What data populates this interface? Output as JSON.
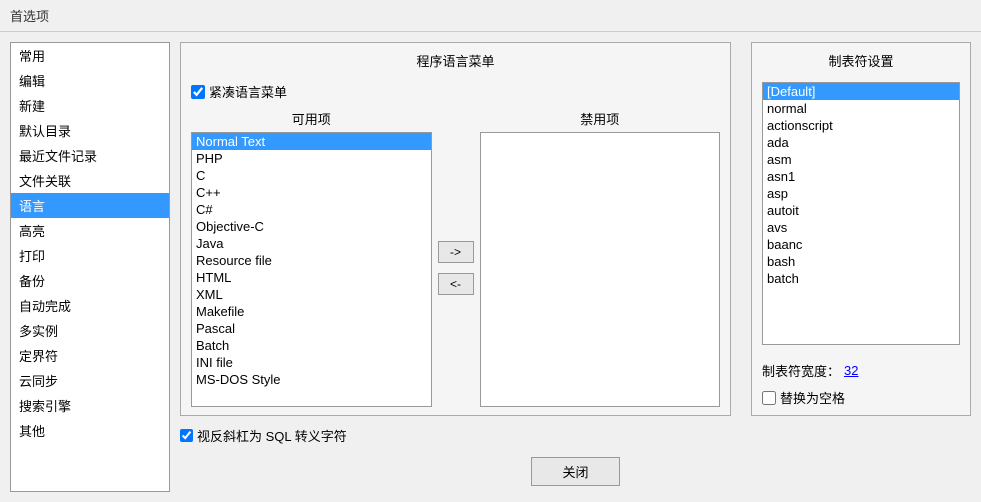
{
  "titleBar": {
    "title": "首选项"
  },
  "sidebar": {
    "items": [
      {
        "label": "常用",
        "active": false
      },
      {
        "label": "编辑",
        "active": false
      },
      {
        "label": "新建",
        "active": false
      },
      {
        "label": "默认目录",
        "active": false
      },
      {
        "label": "最近文件记录",
        "active": false
      },
      {
        "label": "文件关联",
        "active": false
      },
      {
        "label": "语言",
        "active": true
      },
      {
        "label": "高亮",
        "active": false
      },
      {
        "label": "打印",
        "active": false
      },
      {
        "label": "备份",
        "active": false
      },
      {
        "label": "自动完成",
        "active": false
      },
      {
        "label": "多实例",
        "active": false
      },
      {
        "label": "定界符",
        "active": false
      },
      {
        "label": "云同步",
        "active": false
      },
      {
        "label": "搜索引擎",
        "active": false
      },
      {
        "label": "其他",
        "active": false
      }
    ]
  },
  "langPanel": {
    "title": "程序语言菜单",
    "compactCheckbox": {
      "label": "紧凑语言菜单",
      "checked": true
    },
    "availableLabel": "可用项",
    "disabledLabel": "禁用项",
    "availableItems": [
      {
        "label": "Normal Text",
        "selected": true
      },
      {
        "label": "PHP",
        "selected": false
      },
      {
        "label": "C",
        "selected": false
      },
      {
        "label": "C++",
        "selected": false
      },
      {
        "label": "C#",
        "selected": false
      },
      {
        "label": "Objective-C",
        "selected": false
      },
      {
        "label": "Java",
        "selected": false
      },
      {
        "label": "Resource file",
        "selected": false
      },
      {
        "label": "HTML",
        "selected": false
      },
      {
        "label": "XML",
        "selected": false
      },
      {
        "label": "Makefile",
        "selected": false
      },
      {
        "label": "Pascal",
        "selected": false
      },
      {
        "label": "Batch",
        "selected": false
      },
      {
        "label": "INI file",
        "selected": false
      },
      {
        "label": "MS-DOS Style",
        "selected": false
      }
    ],
    "disabledItems": [],
    "arrowRight": "->",
    "arrowLeft": "<-"
  },
  "tabstopPanel": {
    "title": "制表符设置",
    "items": [
      {
        "label": "[Default]",
        "selected": true
      },
      {
        "label": "normal",
        "selected": false
      },
      {
        "label": "actionscript",
        "selected": false
      },
      {
        "label": "ada",
        "selected": false
      },
      {
        "label": "asm",
        "selected": false
      },
      {
        "label": "asn1",
        "selected": false
      },
      {
        "label": "asp",
        "selected": false
      },
      {
        "label": "autoit",
        "selected": false
      },
      {
        "label": "avs",
        "selected": false
      },
      {
        "label": "baanc",
        "selected": false
      },
      {
        "label": "bash",
        "selected": false
      },
      {
        "label": "batch",
        "selected": false
      }
    ],
    "tabWidthLabel": "制表符宽度：",
    "tabWidthValue": "32",
    "replaceCheckbox": {
      "label": "替换为空格",
      "checked": false
    }
  },
  "sqlRow": {
    "checkbox": {
      "label": "视反斜杠为 SQL 转义字符",
      "checked": true
    }
  },
  "closeButton": {
    "label": "关闭"
  }
}
